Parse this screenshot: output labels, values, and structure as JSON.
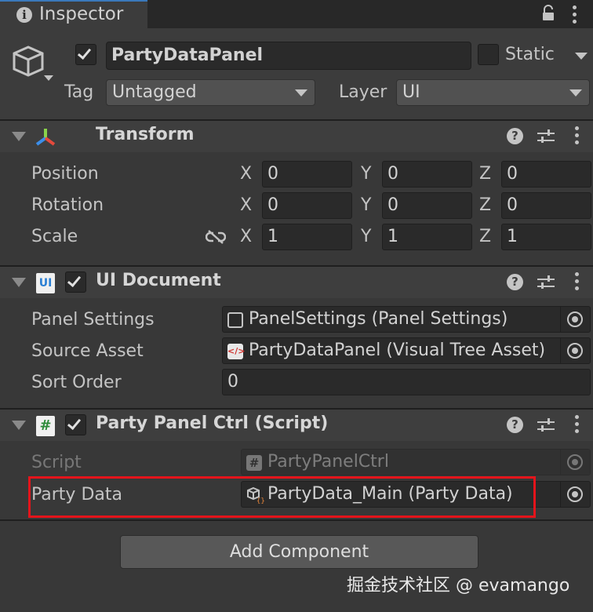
{
  "tab": {
    "title": "Inspector"
  },
  "header": {
    "active": true,
    "object_name": "PartyDataPanel",
    "static_label": "Static",
    "static_checked": false,
    "tag_label": "Tag",
    "tag_value": "Untagged",
    "layer_label": "Layer",
    "layer_value": "UI"
  },
  "transform": {
    "title": "Transform",
    "rows": [
      {
        "label": "Position",
        "x": "0",
        "y": "0",
        "z": "0"
      },
      {
        "label": "Rotation",
        "x": "0",
        "y": "0",
        "z": "0"
      },
      {
        "label": "Scale",
        "x": "1",
        "y": "1",
        "z": "1"
      }
    ],
    "axis": {
      "x": "X",
      "y": "Y",
      "z": "Z"
    }
  },
  "ui_document": {
    "title": "UI Document",
    "enabled": true,
    "icon_text": "UI",
    "panel_settings_label": "Panel Settings",
    "panel_settings_value": "PanelSettings (Panel Settings)",
    "source_asset_label": "Source Asset",
    "source_asset_value": "PartyDataPanel (Visual Tree Asset)",
    "sort_order_label": "Sort Order",
    "sort_order_value": "0"
  },
  "script_component": {
    "title": "Party Panel Ctrl (Script)",
    "enabled": true,
    "icon_text": "#",
    "script_label": "Script",
    "script_value": "PartyPanelCtrl",
    "party_data_label": "Party Data",
    "party_data_value": "PartyData_Main (Party Data)"
  },
  "add_component_label": "Add Component",
  "watermark": "掘金技术社区 @ evamango",
  "colors": {
    "highlight": "#e4141b",
    "tab_accent": "#3a79bb",
    "background": "#383838"
  }
}
